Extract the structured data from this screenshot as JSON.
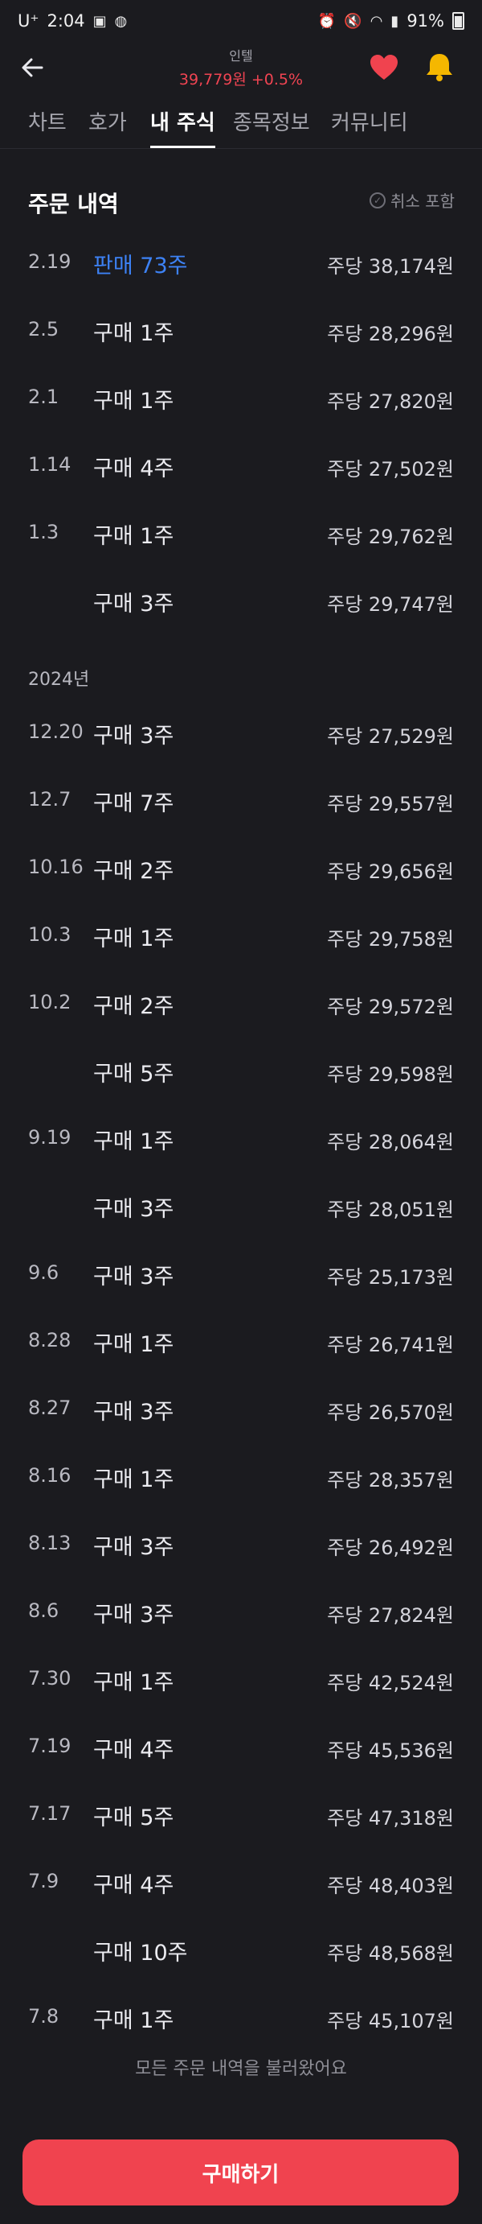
{
  "status_bar": {
    "carrier": "U⁺",
    "time": "2:04",
    "battery": "91%"
  },
  "header": {
    "stock_name": "인텔",
    "price": "39,779원",
    "change": "+0.5%"
  },
  "tabs": [
    {
      "label": "차트",
      "active": false
    },
    {
      "label": "호가",
      "active": false
    },
    {
      "label": "내 주식",
      "active": true
    },
    {
      "label": "종목정보",
      "active": false
    },
    {
      "label": "커뮤니티",
      "active": false
    }
  ],
  "orders_section": {
    "title": "주문 내역",
    "cancel_toggle": "취소 포함",
    "year_label": "2024년"
  },
  "orders": [
    {
      "date": "2.19",
      "type": "판매 73주",
      "price": "주당 38,174원",
      "sell": true
    },
    {
      "date": "2.5",
      "type": "구매 1주",
      "price": "주당 28,296원"
    },
    {
      "date": "2.1",
      "type": "구매 1주",
      "price": "주당 27,820원"
    },
    {
      "date": "1.14",
      "type": "구매 4주",
      "price": "주당 27,502원"
    },
    {
      "date": "1.3",
      "type": "구매 1주",
      "price": "주당 29,762원"
    },
    {
      "date": "",
      "type": "구매 3주",
      "price": "주당 29,747원"
    },
    {
      "date": "12.20",
      "type": "구매 3주",
      "price": "주당 27,529원"
    },
    {
      "date": "12.7",
      "type": "구매 7주",
      "price": "주당 29,557원"
    },
    {
      "date": "10.16",
      "type": "구매 2주",
      "price": "주당 29,656원"
    },
    {
      "date": "10.3",
      "type": "구매 1주",
      "price": "주당 29,758원"
    },
    {
      "date": "10.2",
      "type": "구매 2주",
      "price": "주당 29,572원"
    },
    {
      "date": "",
      "type": "구매 5주",
      "price": "주당 29,598원"
    },
    {
      "date": "9.19",
      "type": "구매 1주",
      "price": "주당 28,064원"
    },
    {
      "date": "",
      "type": "구매 3주",
      "price": "주당 28,051원"
    },
    {
      "date": "9.6",
      "type": "구매 3주",
      "price": "주당 25,173원"
    },
    {
      "date": "8.28",
      "type": "구매 1주",
      "price": "주당 26,741원"
    },
    {
      "date": "8.27",
      "type": "구매 3주",
      "price": "주당 26,570원"
    },
    {
      "date": "8.16",
      "type": "구매 1주",
      "price": "주당 28,357원"
    },
    {
      "date": "8.13",
      "type": "구매 3주",
      "price": "주당 26,492원"
    },
    {
      "date": "8.6",
      "type": "구매 3주",
      "price": "주당 27,824원"
    },
    {
      "date": "7.30",
      "type": "구매 1주",
      "price": "주당 42,524원"
    },
    {
      "date": "7.19",
      "type": "구매 4주",
      "price": "주당 45,536원"
    },
    {
      "date": "7.17",
      "type": "구매 5주",
      "price": "주당 47,318원"
    },
    {
      "date": "7.9",
      "type": "구매 4주",
      "price": "주당 48,403원"
    },
    {
      "date": "",
      "type": "구매 10주",
      "price": "주당 48,568원"
    },
    {
      "date": "7.8",
      "type": "구매 1주",
      "price": "주당 45,107원"
    }
  ],
  "footer_note": "모든 주문 내역을 불러왔어요",
  "buy_button": "구매하기",
  "colors": {
    "background": "#1b1b1f",
    "accent_red": "#f04452",
    "sell_blue": "#3d82f5"
  }
}
